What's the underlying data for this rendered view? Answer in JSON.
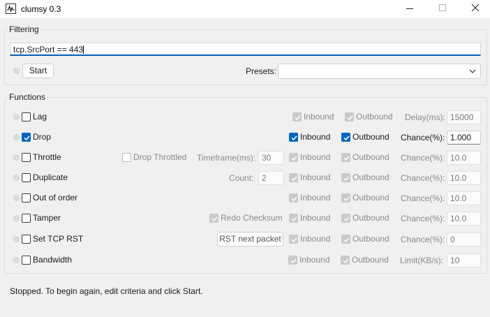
{
  "window": {
    "title": "clumsy 0.3"
  },
  "filtering": {
    "legend": "Filtering",
    "filter_value": "tcp.SrcPort == 443",
    "start_label": "Start",
    "presets_label": "Presets:",
    "presets_value": ""
  },
  "functions": {
    "legend": "Functions",
    "rows": [
      {
        "name": "Lag",
        "enabled": false,
        "inbound_label": "Inbound",
        "outbound_label": "Outbound",
        "param_label": "Delay(ms):",
        "param_value": "15000"
      },
      {
        "name": "Drop",
        "enabled": true,
        "inbound_label": "Inbound",
        "outbound_label": "Outbound",
        "param_label": "Chance(%):",
        "param_value": "1.000"
      },
      {
        "name": "Throttle",
        "enabled": false,
        "extra_check_label": "Drop Throttled",
        "extra_label": "Timeframe(ms):",
        "extra_value": "30",
        "inbound_label": "Inbound",
        "outbound_label": "Outbound",
        "param_label": "Chance(%):",
        "param_value": "10.0"
      },
      {
        "name": "Duplicate",
        "enabled": false,
        "extra_label": "Count:",
        "extra_value": "2",
        "inbound_label": "Inbound",
        "outbound_label": "Outbound",
        "param_label": "Chance(%):",
        "param_value": "10.0"
      },
      {
        "name": "Out of order",
        "enabled": false,
        "inbound_label": "Inbound",
        "outbound_label": "Outbound",
        "param_label": "Chance(%):",
        "param_value": "10.0"
      },
      {
        "name": "Tamper",
        "enabled": false,
        "extra_check_label": "Redo Checksum",
        "inbound_label": "Inbound",
        "outbound_label": "Outbound",
        "param_label": "Chance(%):",
        "param_value": "10.0"
      },
      {
        "name": "Set TCP RST",
        "enabled": false,
        "extra_button_label": "RST next packet",
        "inbound_label": "Inbound",
        "outbound_label": "Outbound",
        "param_label": "Chance(%):",
        "param_value": "0"
      },
      {
        "name": "Bandwidth",
        "enabled": false,
        "inbound_label": "Inbound",
        "outbound_label": "Outbound",
        "param_label": "Limit(KB/s):",
        "param_value": "10"
      }
    ]
  },
  "status": {
    "text": "Stopped. To begin again, edit criteria and click Start."
  },
  "colors": {
    "accent": "#0067c0",
    "focus_underline": "#005fb8"
  }
}
